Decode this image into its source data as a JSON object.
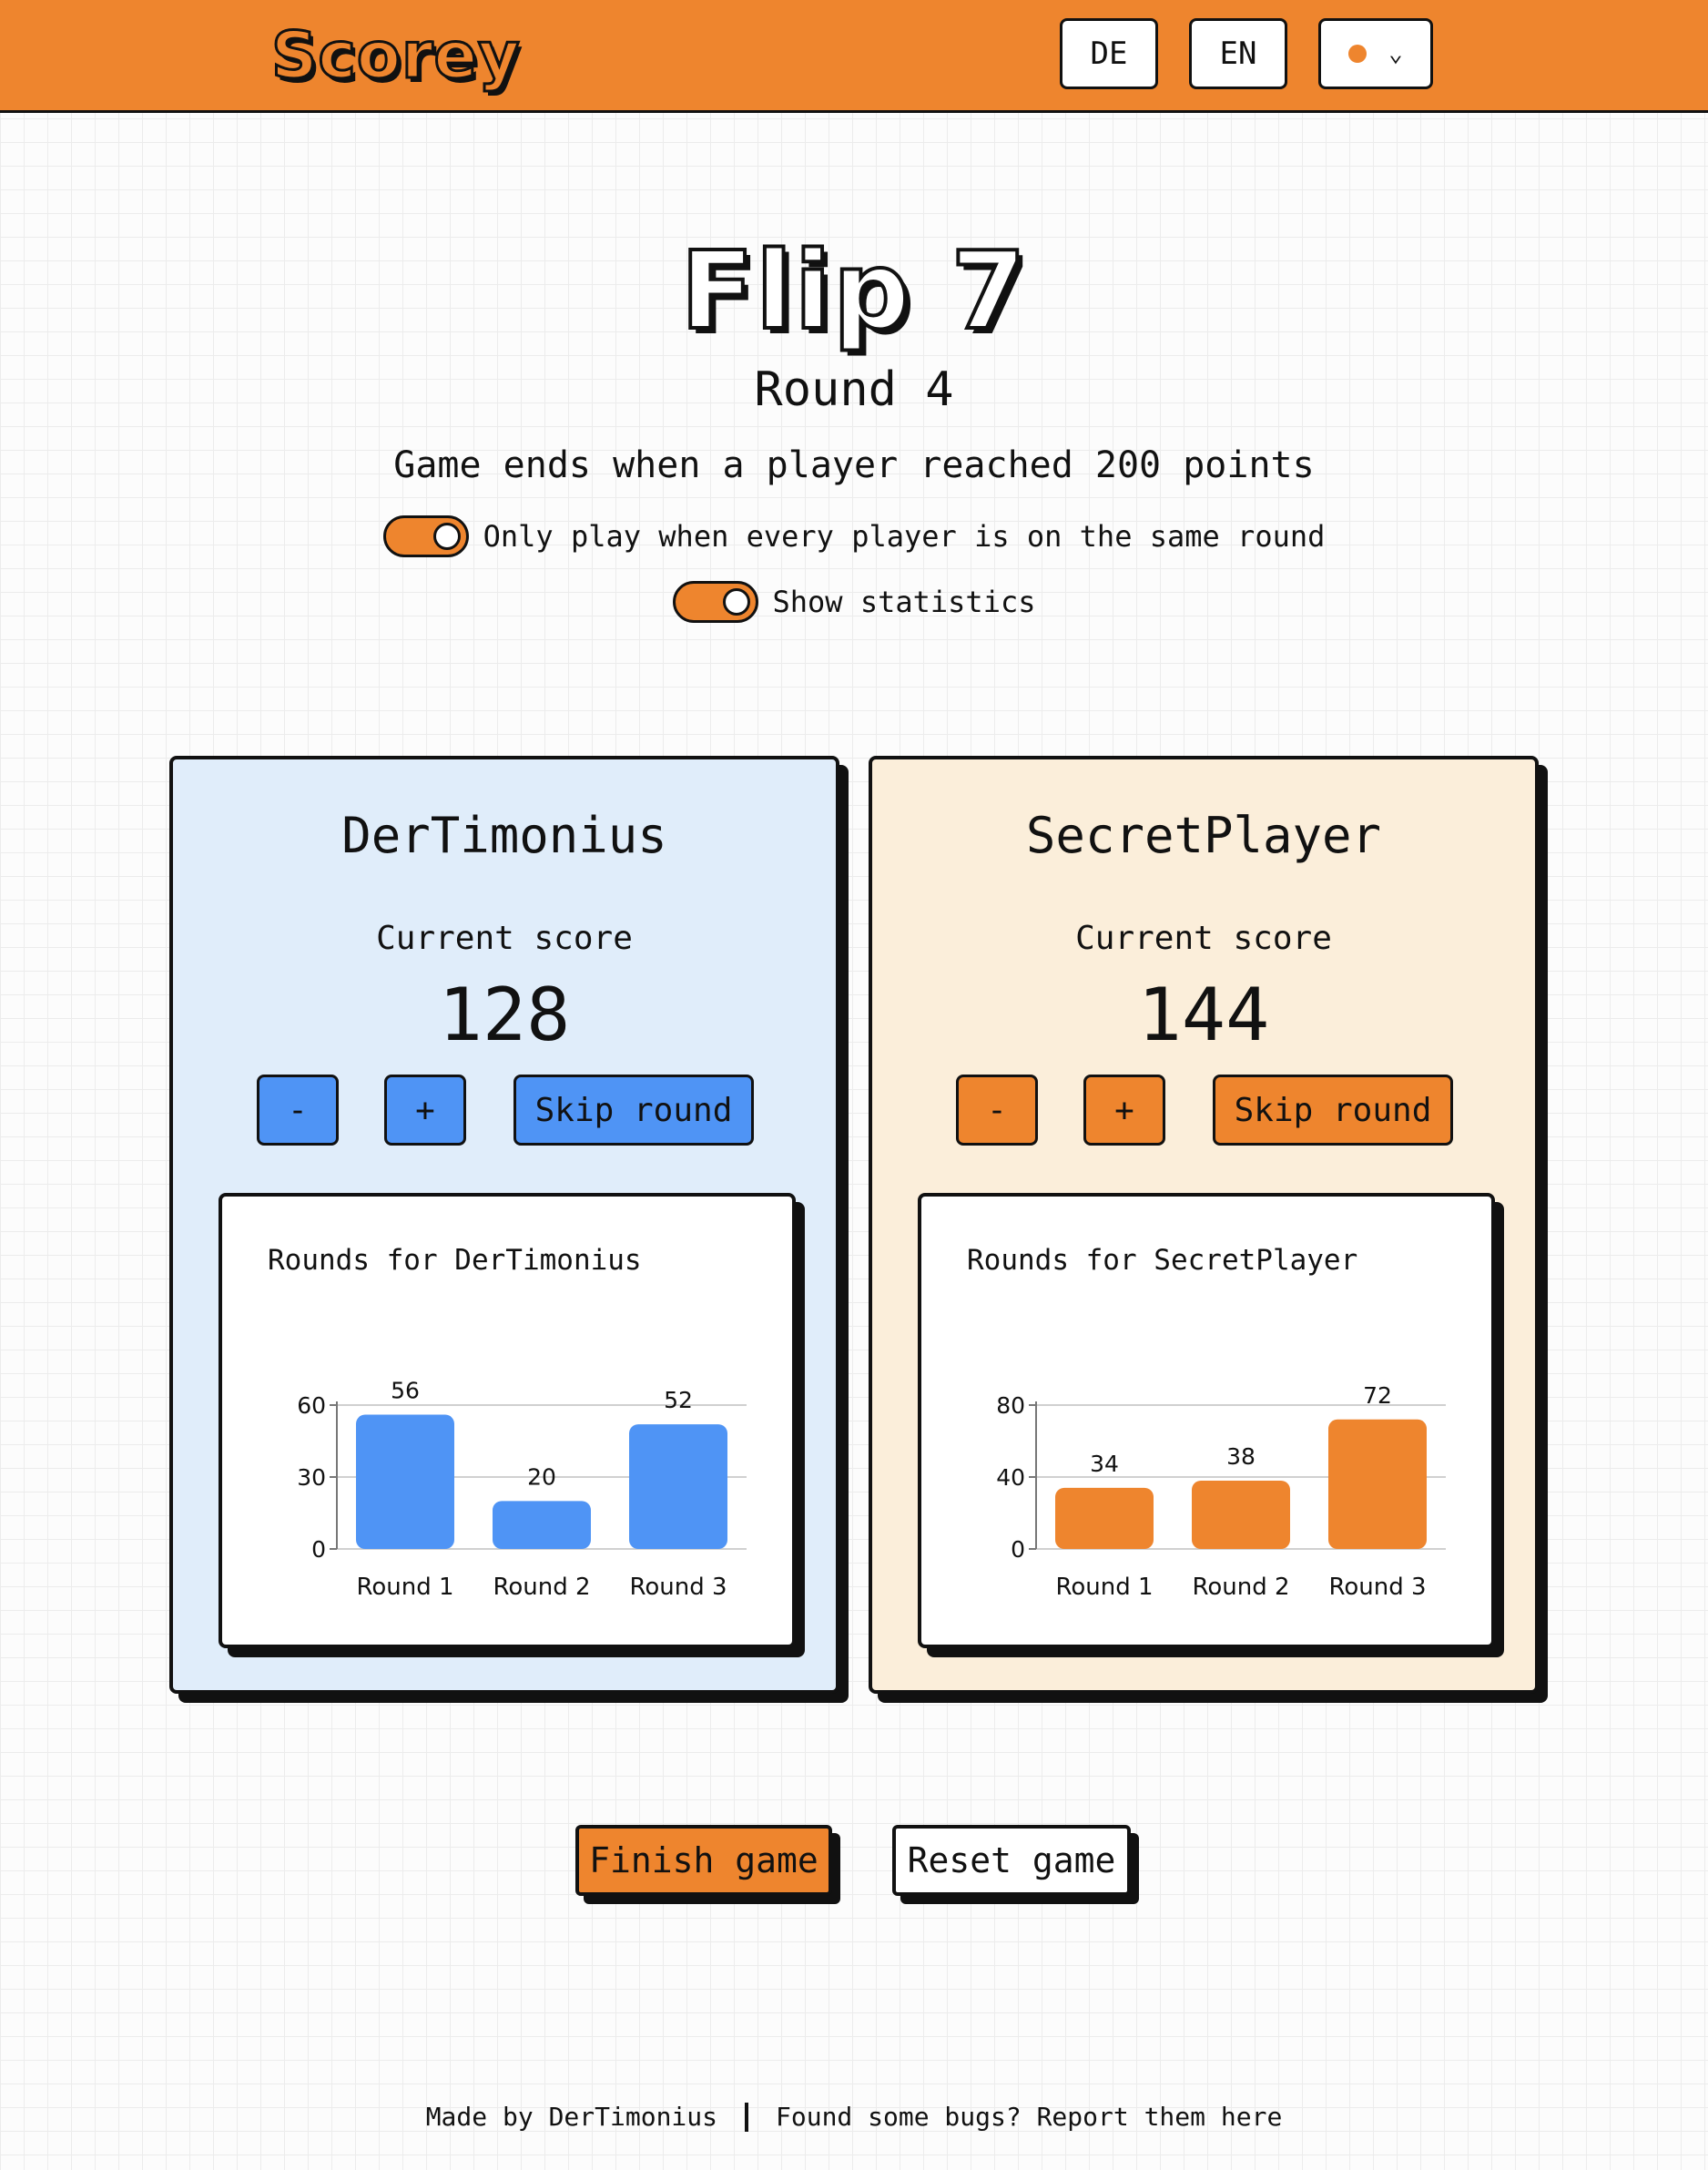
{
  "header": {
    "logo": "Scorey",
    "lang_de": "DE",
    "lang_en": "EN",
    "theme_icon": "orange-dot-icon",
    "dropdown_icon": "chevron-down-icon"
  },
  "game": {
    "title": "Flip 7",
    "round_label": "Round 4",
    "end_condition": "Game ends when a player reached 200 points",
    "toggle_same_round": {
      "label": "Only play when every player is on the same round",
      "on": true
    },
    "toggle_statistics": {
      "label": "Show statistics",
      "on": true
    }
  },
  "players": [
    {
      "name": "DerTimonius",
      "score_label": "Current score",
      "score": "128",
      "minus_label": "-",
      "plus_label": "+",
      "skip_label": "Skip round",
      "color": "#4f94f5",
      "chart_title": "Rounds for DerTimonius"
    },
    {
      "name": "SecretPlayer",
      "score_label": "Current score",
      "score": "144",
      "minus_label": "-",
      "plus_label": "+",
      "skip_label": "Skip round",
      "color": "#ee852e",
      "chart_title": "Rounds for SecretPlayer"
    }
  ],
  "chart_data": [
    {
      "type": "bar",
      "title": "Rounds for DerTimonius",
      "categories": [
        "Round 1",
        "Round 2",
        "Round 3"
      ],
      "values": [
        56,
        20,
        52
      ],
      "yticks": [
        0,
        30,
        60
      ],
      "ylim": [
        0,
        60
      ],
      "color": "#4f94f5"
    },
    {
      "type": "bar",
      "title": "Rounds for SecretPlayer",
      "categories": [
        "Round 1",
        "Round 2",
        "Round 3"
      ],
      "values": [
        34,
        38,
        72
      ],
      "yticks": [
        0,
        40,
        80
      ],
      "ylim": [
        0,
        80
      ],
      "color": "#ee852e"
    }
  ],
  "actions": {
    "finish_label": "Finish game",
    "reset_label": "Reset game"
  },
  "footer": {
    "made_by": "Made by DerTimonius",
    "bugs": "Found some bugs? Report them here"
  }
}
